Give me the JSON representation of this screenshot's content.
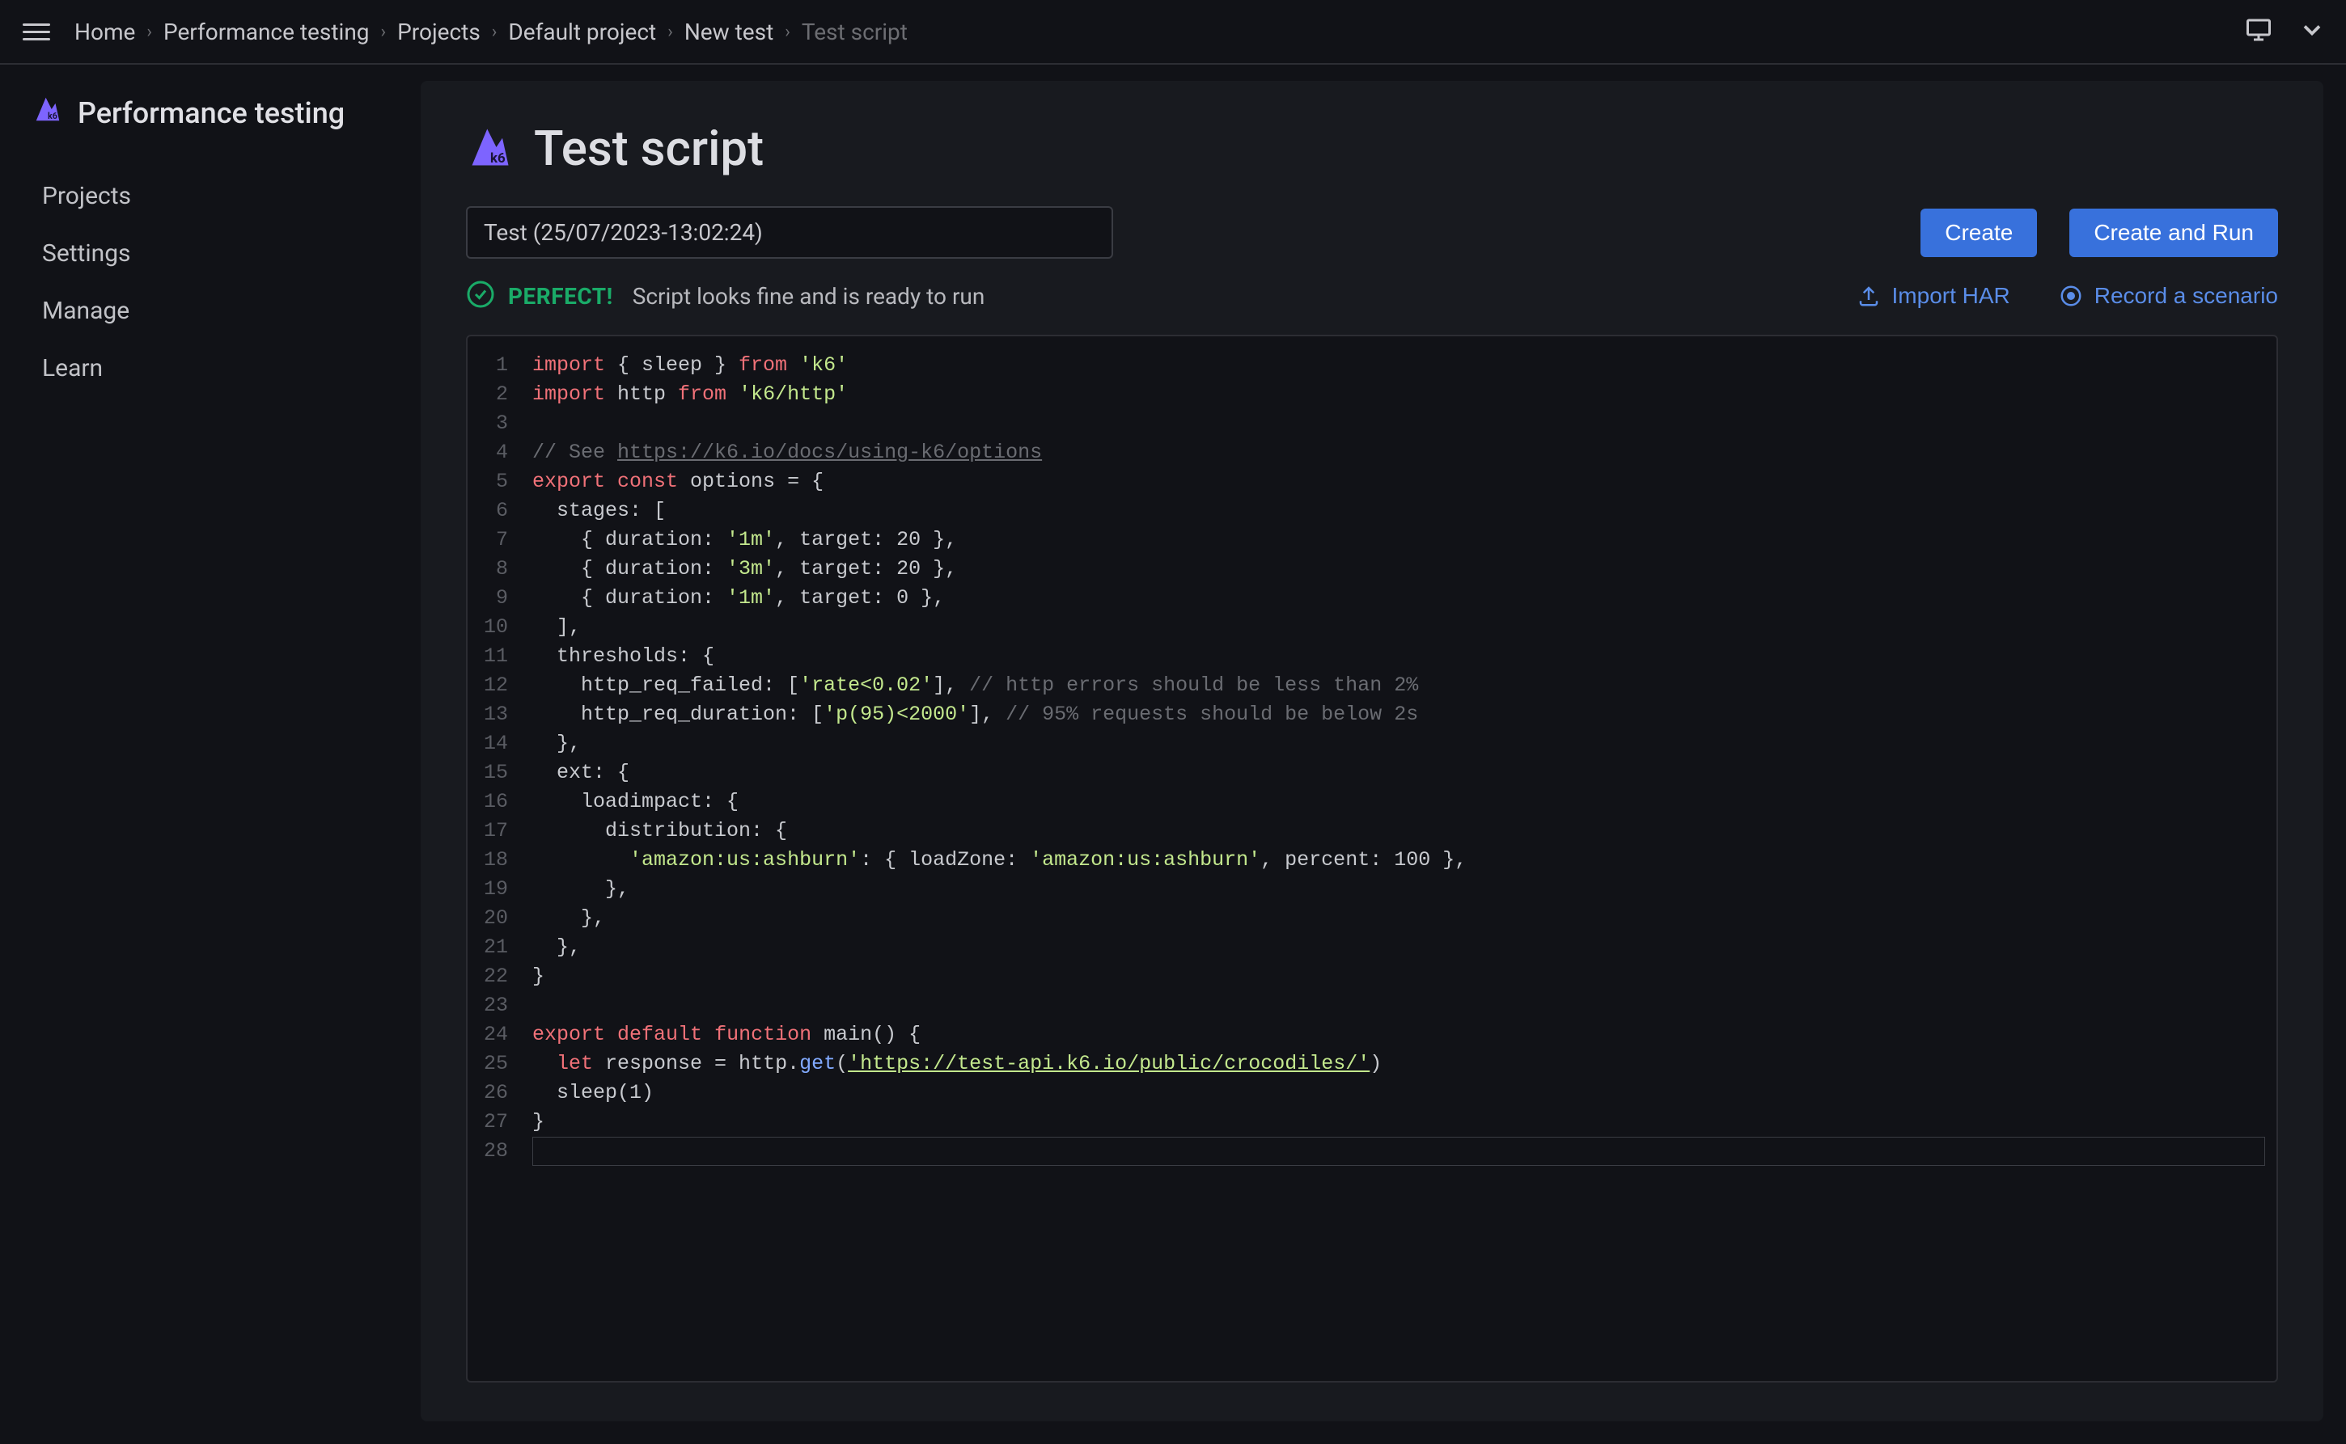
{
  "breadcrumb": [
    "Home",
    "Performance testing",
    "Projects",
    "Default project",
    "New test",
    "Test script"
  ],
  "topbar": {
    "monitor_icon": "monitor-icon",
    "chevron_icon": "chevron-down-icon"
  },
  "sidebar": {
    "title": "Performance testing",
    "items": [
      "Projects",
      "Settings",
      "Manage",
      "Learn"
    ]
  },
  "page": {
    "title": "Test script",
    "test_name": "Test (25/07/2023-13:02:24)",
    "create_label": "Create",
    "create_run_label": "Create and Run",
    "status_badge": "PERFECT!",
    "status_message": "Script looks fine and is ready to run",
    "import_har_label": "Import HAR",
    "record_label": "Record a scenario"
  },
  "code": {
    "lines": [
      [
        {
          "t": "keyword",
          "v": "import"
        },
        {
          "t": "plain",
          "v": " { sleep } "
        },
        {
          "t": "keyword",
          "v": "from"
        },
        {
          "t": "plain",
          "v": " "
        },
        {
          "t": "string",
          "v": "'k6'"
        }
      ],
      [
        {
          "t": "keyword",
          "v": "import"
        },
        {
          "t": "plain",
          "v": " http "
        },
        {
          "t": "keyword",
          "v": "from"
        },
        {
          "t": "plain",
          "v": " "
        },
        {
          "t": "string",
          "v": "'k6/http'"
        }
      ],
      [],
      [
        {
          "t": "comment",
          "v": "// See "
        },
        {
          "t": "url-comment",
          "v": "https://k6.io/docs/using-k6/options"
        }
      ],
      [
        {
          "t": "keyword",
          "v": "export"
        },
        {
          "t": "plain",
          "v": " "
        },
        {
          "t": "keyword",
          "v": "const"
        },
        {
          "t": "plain",
          "v": " options = {"
        }
      ],
      [
        {
          "t": "plain",
          "v": "  stages: ["
        }
      ],
      [
        {
          "t": "plain",
          "v": "    { duration: "
        },
        {
          "t": "string",
          "v": "'1m'"
        },
        {
          "t": "plain",
          "v": ", target: 20 },"
        }
      ],
      [
        {
          "t": "plain",
          "v": "    { duration: "
        },
        {
          "t": "string",
          "v": "'3m'"
        },
        {
          "t": "plain",
          "v": ", target: 20 },"
        }
      ],
      [
        {
          "t": "plain",
          "v": "    { duration: "
        },
        {
          "t": "string",
          "v": "'1m'"
        },
        {
          "t": "plain",
          "v": ", target: 0 },"
        }
      ],
      [
        {
          "t": "plain",
          "v": "  ],"
        }
      ],
      [
        {
          "t": "plain",
          "v": "  thresholds: {"
        }
      ],
      [
        {
          "t": "plain",
          "v": "    http_req_failed: ["
        },
        {
          "t": "string",
          "v": "'rate<0.02'"
        },
        {
          "t": "plain",
          "v": "], "
        },
        {
          "t": "comment",
          "v": "// http errors should be less than 2%"
        }
      ],
      [
        {
          "t": "plain",
          "v": "    http_req_duration: ["
        },
        {
          "t": "string",
          "v": "'p(95)<2000'"
        },
        {
          "t": "plain",
          "v": "], "
        },
        {
          "t": "comment",
          "v": "// 95% requests should be below 2s"
        }
      ],
      [
        {
          "t": "plain",
          "v": "  },"
        }
      ],
      [
        {
          "t": "plain",
          "v": "  ext: {"
        }
      ],
      [
        {
          "t": "plain",
          "v": "    loadimpact: {"
        }
      ],
      [
        {
          "t": "plain",
          "v": "      distribution: {"
        }
      ],
      [
        {
          "t": "plain",
          "v": "        "
        },
        {
          "t": "string",
          "v": "'amazon:us:ashburn'"
        },
        {
          "t": "plain",
          "v": ": { loadZone: "
        },
        {
          "t": "string",
          "v": "'amazon:us:ashburn'"
        },
        {
          "t": "plain",
          "v": ", percent: 100 },"
        }
      ],
      [
        {
          "t": "plain",
          "v": "      },"
        }
      ],
      [
        {
          "t": "plain",
          "v": "    },"
        }
      ],
      [
        {
          "t": "plain",
          "v": "  },"
        }
      ],
      [
        {
          "t": "plain",
          "v": "}"
        }
      ],
      [],
      [
        {
          "t": "keyword",
          "v": "export"
        },
        {
          "t": "plain",
          "v": " "
        },
        {
          "t": "keyword",
          "v": "default"
        },
        {
          "t": "plain",
          "v": " "
        },
        {
          "t": "keyword",
          "v": "function"
        },
        {
          "t": "plain",
          "v": " main() {"
        }
      ],
      [
        {
          "t": "plain",
          "v": "  "
        },
        {
          "t": "keyword",
          "v": "let"
        },
        {
          "t": "plain",
          "v": " response = http."
        },
        {
          "t": "func",
          "v": "get"
        },
        {
          "t": "plain",
          "v": "("
        },
        {
          "t": "url",
          "v": "'https://test-api.k6.io/public/crocodiles/'"
        },
        {
          "t": "plain",
          "v": ")"
        }
      ],
      [
        {
          "t": "plain",
          "v": "  sleep(1)"
        }
      ],
      [
        {
          "t": "plain",
          "v": "}"
        }
      ],
      []
    ]
  }
}
